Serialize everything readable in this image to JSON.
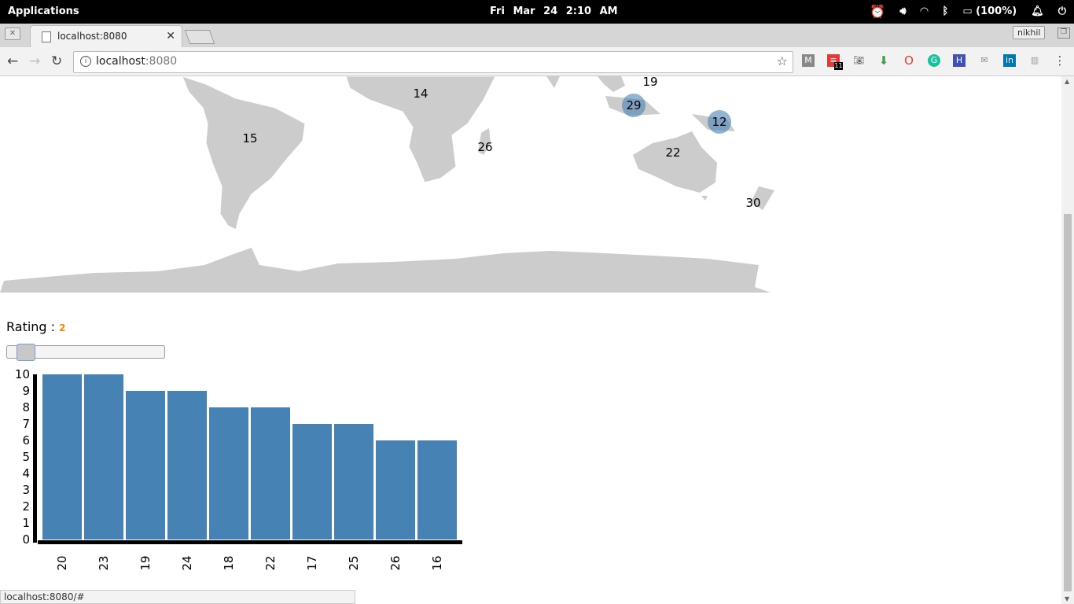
{
  "system_bar": {
    "applications": "Applications",
    "clock": "Fri Mar 24   2:10 AM",
    "battery": "(100%)"
  },
  "tab": {
    "title": "localhost:8080"
  },
  "user_button": "nikhil",
  "omnibox": {
    "host": "localhost",
    "port": ":8080"
  },
  "extension_badge": "11",
  "map": {
    "labels": [
      {
        "text": "14"
      },
      {
        "text": "19"
      },
      {
        "text": "15"
      },
      {
        "text": "26"
      },
      {
        "text": "22"
      },
      {
        "text": "30"
      }
    ],
    "clusters": [
      {
        "text": "29"
      },
      {
        "text": "12"
      }
    ]
  },
  "rating": {
    "label": "Rating :",
    "value": "2"
  },
  "chart_data": {
    "type": "bar",
    "categories": [
      "20",
      "23",
      "19",
      "24",
      "18",
      "22",
      "17",
      "25",
      "26",
      "16"
    ],
    "values": [
      10,
      10,
      9,
      9,
      8,
      8,
      7,
      7,
      6,
      6
    ],
    "ylim": [
      0,
      10
    ],
    "yticks": [
      "0",
      "1",
      "2",
      "3",
      "4",
      "5",
      "6",
      "7",
      "8",
      "9",
      "10"
    ],
    "bar_color": "#4682b4"
  },
  "status_url": "localhost:8080/#"
}
